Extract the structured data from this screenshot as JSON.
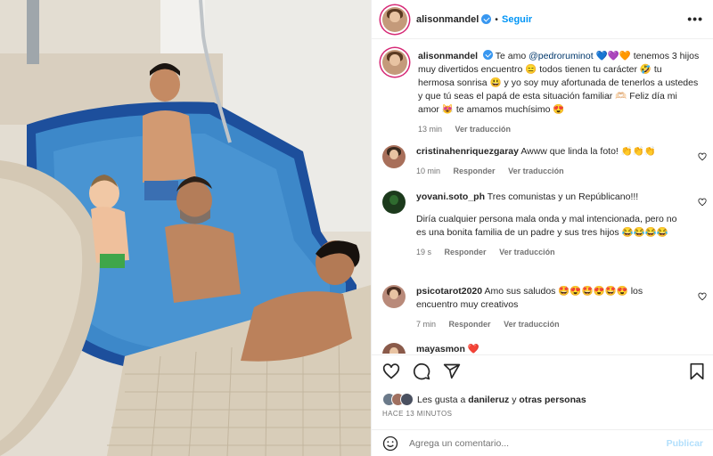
{
  "header": {
    "username": "alisonmandel",
    "separator": "•",
    "follow_label": "Seguir",
    "more_label": "•••"
  },
  "caption": {
    "username": "alisonmandel",
    "text_before": "Te amo ",
    "mention": "@pedroruminot",
    "text_after": " 💙💜🧡 tenemos 3 hijos muy divertidos encuentro 😑 todos tienen tu carácter 🤣 tu hermosa sonrisa 😃 y yo soy muy afortunada de tenerlos a ustedes y que tú seas el papá de esta situación familiar 🫶🏻 Feliz día mi amor 😻 te amamos muchísimo 😍",
    "time": "13 min",
    "translate": "Ver traducción"
  },
  "comments": [
    {
      "username": "cristinahenriquezgaray",
      "text": "Awww que linda la foto! 👏👏👏",
      "time": "10 min",
      "reply": "Responder",
      "translate": "Ver traducción",
      "avatar_color": "#a86f5a"
    },
    {
      "username": "yovani.soto_ph",
      "text": "Tres comunistas y un Repúblicano!!!",
      "extra": "Diría cualquier persona mala onda y mal intencionada, pero no es una bonita familia de un padre y sus tres hijos 😂😂😂😂",
      "time": "19 s",
      "reply": "Responder",
      "translate": "Ver traducción",
      "avatar_color": "#1c3a1c"
    },
    {
      "username": "psicotarot2020",
      "text": "Amo sus saludos 🤩😍🤩😍🤩😍 los encuentro muy creativos",
      "time": "7 min",
      "reply": "Responder",
      "translate": "Ver traducción",
      "avatar_color": "#b98a7a"
    },
    {
      "username": "mayasmon",
      "text": "❤️",
      "avatar_color": "#8a5a4a"
    }
  ],
  "likes": {
    "prefix": "Les gusta a ",
    "first_user": "danileruz",
    "connector": " y ",
    "others": "otras personas"
  },
  "posted_ago": "HACE 13 MINUTOS",
  "comment_input": {
    "placeholder": "Agrega un comentario...",
    "publish_label": "Publicar"
  },
  "colors": {
    "link_blue": "#0095f6",
    "mention_blue": "#00376b",
    "muted_gray": "#737373",
    "story_ring": "#d62976"
  },
  "icons": [
    "heart-icon",
    "comment-icon",
    "share-icon",
    "bookmark-icon",
    "emoji-icon",
    "verified-icon",
    "more-icon"
  ]
}
